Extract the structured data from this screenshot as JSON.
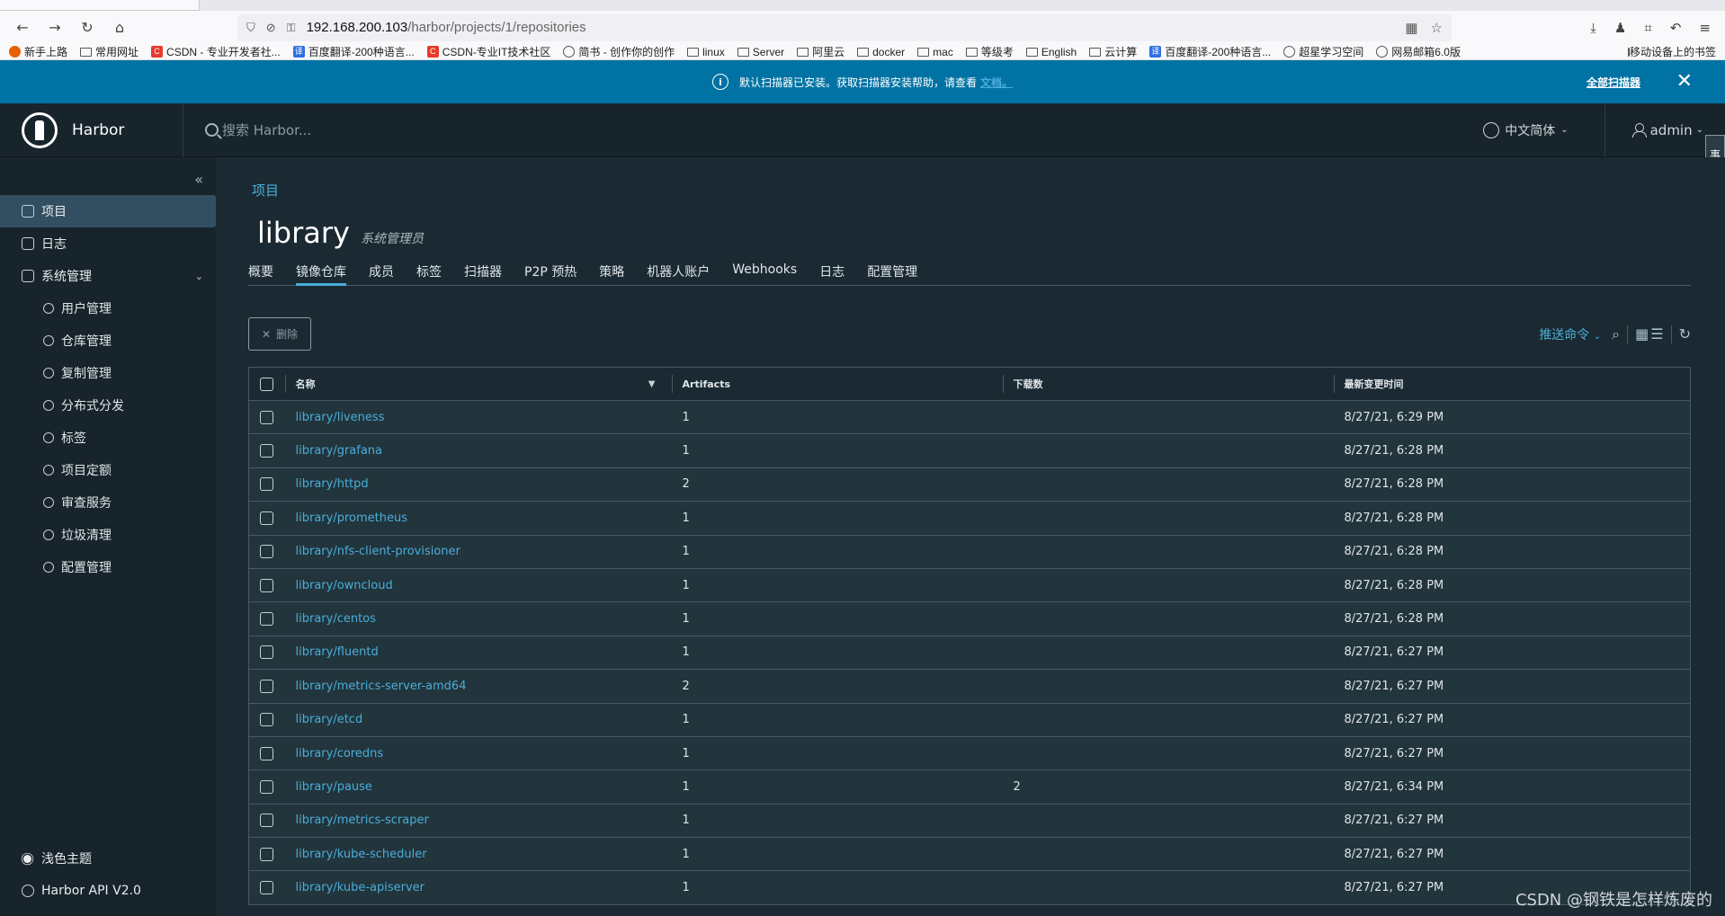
{
  "browser": {
    "url_host": "192.168.200.103",
    "url_path": "/harbor/projects/1/repositories",
    "bookmarks": [
      {
        "label": "新手上路",
        "icon": "firefox-icon"
      },
      {
        "label": "常用网址",
        "icon": "folder-icon"
      },
      {
        "label": "CSDN - 专业开发者社...",
        "icon": "csdn-icon"
      },
      {
        "label": "百度翻译-200种语言...",
        "icon": "translate-icon"
      },
      {
        "label": "CSDN-专业IT技术社区",
        "icon": "csdn-icon"
      },
      {
        "label": "简书 - 创作你的创作",
        "icon": "globe-icon"
      },
      {
        "label": "linux",
        "icon": "folder-icon"
      },
      {
        "label": "Server",
        "icon": "folder-icon"
      },
      {
        "label": "阿里云",
        "icon": "folder-icon"
      },
      {
        "label": "docker",
        "icon": "folder-icon"
      },
      {
        "label": "mac",
        "icon": "folder-icon"
      },
      {
        "label": "等级考",
        "icon": "folder-icon"
      },
      {
        "label": "English",
        "icon": "folder-icon"
      },
      {
        "label": "云计算",
        "icon": "folder-icon"
      },
      {
        "label": "百度翻译-200种语言...",
        "icon": "translate-icon"
      },
      {
        "label": "超星学习空间",
        "icon": "globe-icon"
      },
      {
        "label": "网易邮箱6.0版",
        "icon": "globe-icon"
      }
    ],
    "mobile_bookmarks": "移动设备上的书签"
  },
  "banner": {
    "message": "默认扫描器已安装。获取扫描器安装帮助，请查看",
    "link": "文档。",
    "action": "全部扫描器"
  },
  "header": {
    "brand": "Harbor",
    "search_placeholder": "搜索 Harbor...",
    "language": "中文简体",
    "user": "admin",
    "side_tab": "事件日志"
  },
  "sidebar": {
    "items": [
      {
        "label": "项目",
        "icon": "project-icon",
        "active": true
      },
      {
        "label": "日志",
        "icon": "log-icon"
      },
      {
        "label": "系统管理",
        "icon": "admin-icon",
        "expandable": true
      }
    ],
    "sub_items": [
      {
        "label": "用户管理",
        "icon": "users-icon"
      },
      {
        "label": "仓库管理",
        "icon": "registry-icon"
      },
      {
        "label": "复制管理",
        "icon": "replication-icon"
      },
      {
        "label": "分布式分发",
        "icon": "distribution-icon"
      },
      {
        "label": "标签",
        "icon": "tag-icon"
      },
      {
        "label": "项目定额",
        "icon": "quota-icon"
      },
      {
        "label": "审查服务",
        "icon": "shield-icon"
      },
      {
        "label": "垃圾清理",
        "icon": "trash-icon"
      },
      {
        "label": "配置管理",
        "icon": "gear-icon"
      }
    ],
    "theme": "浅色主题",
    "api": "Harbor API V2.0"
  },
  "main": {
    "breadcrumb": "项目",
    "title": "library",
    "role": "系统管理员",
    "tabs": [
      "概要",
      "镜像仓库",
      "成员",
      "标签",
      "扫描器",
      "P2P 预热",
      "策略",
      "机器人账户",
      "Webhooks",
      "日志",
      "配置管理"
    ],
    "active_tab": 1,
    "delete_label": "删除",
    "push_command": "推送命令",
    "columns": [
      "名称",
      "Artifacts",
      "下载数",
      "最新变更时间"
    ],
    "rows": [
      {
        "name": "library/liveness",
        "artifacts": "1",
        "pulls": "",
        "time": "8/27/21, 6:29 PM"
      },
      {
        "name": "library/grafana",
        "artifacts": "1",
        "pulls": "",
        "time": "8/27/21, 6:28 PM"
      },
      {
        "name": "library/httpd",
        "artifacts": "2",
        "pulls": "",
        "time": "8/27/21, 6:28 PM"
      },
      {
        "name": "library/prometheus",
        "artifacts": "1",
        "pulls": "",
        "time": "8/27/21, 6:28 PM"
      },
      {
        "name": "library/nfs-client-provisioner",
        "artifacts": "1",
        "pulls": "",
        "time": "8/27/21, 6:28 PM"
      },
      {
        "name": "library/owncloud",
        "artifacts": "1",
        "pulls": "",
        "time": "8/27/21, 6:28 PM"
      },
      {
        "name": "library/centos",
        "artifacts": "1",
        "pulls": "",
        "time": "8/27/21, 6:28 PM"
      },
      {
        "name": "library/fluentd",
        "artifacts": "1",
        "pulls": "",
        "time": "8/27/21, 6:27 PM"
      },
      {
        "name": "library/metrics-server-amd64",
        "artifacts": "2",
        "pulls": "",
        "time": "8/27/21, 6:27 PM"
      },
      {
        "name": "library/etcd",
        "artifacts": "1",
        "pulls": "",
        "time": "8/27/21, 6:27 PM"
      },
      {
        "name": "library/coredns",
        "artifacts": "1",
        "pulls": "",
        "time": "8/27/21, 6:27 PM"
      },
      {
        "name": "library/pause",
        "artifacts": "1",
        "pulls": "2",
        "time": "8/27/21, 6:34 PM"
      },
      {
        "name": "library/metrics-scraper",
        "artifacts": "1",
        "pulls": "",
        "time": "8/27/21, 6:27 PM"
      },
      {
        "name": "library/kube-scheduler",
        "artifacts": "1",
        "pulls": "",
        "time": "8/27/21, 6:27 PM"
      },
      {
        "name": "library/kube-apiserver",
        "artifacts": "1",
        "pulls": "",
        "time": "8/27/21, 6:27 PM"
      }
    ]
  },
  "watermark": "CSDN @钢铁是怎样炼废的",
  "colors": {
    "accent": "#4aaed9",
    "banner": "#0072a3",
    "bg": "#1b2a32",
    "sidebar": "#17242b"
  }
}
